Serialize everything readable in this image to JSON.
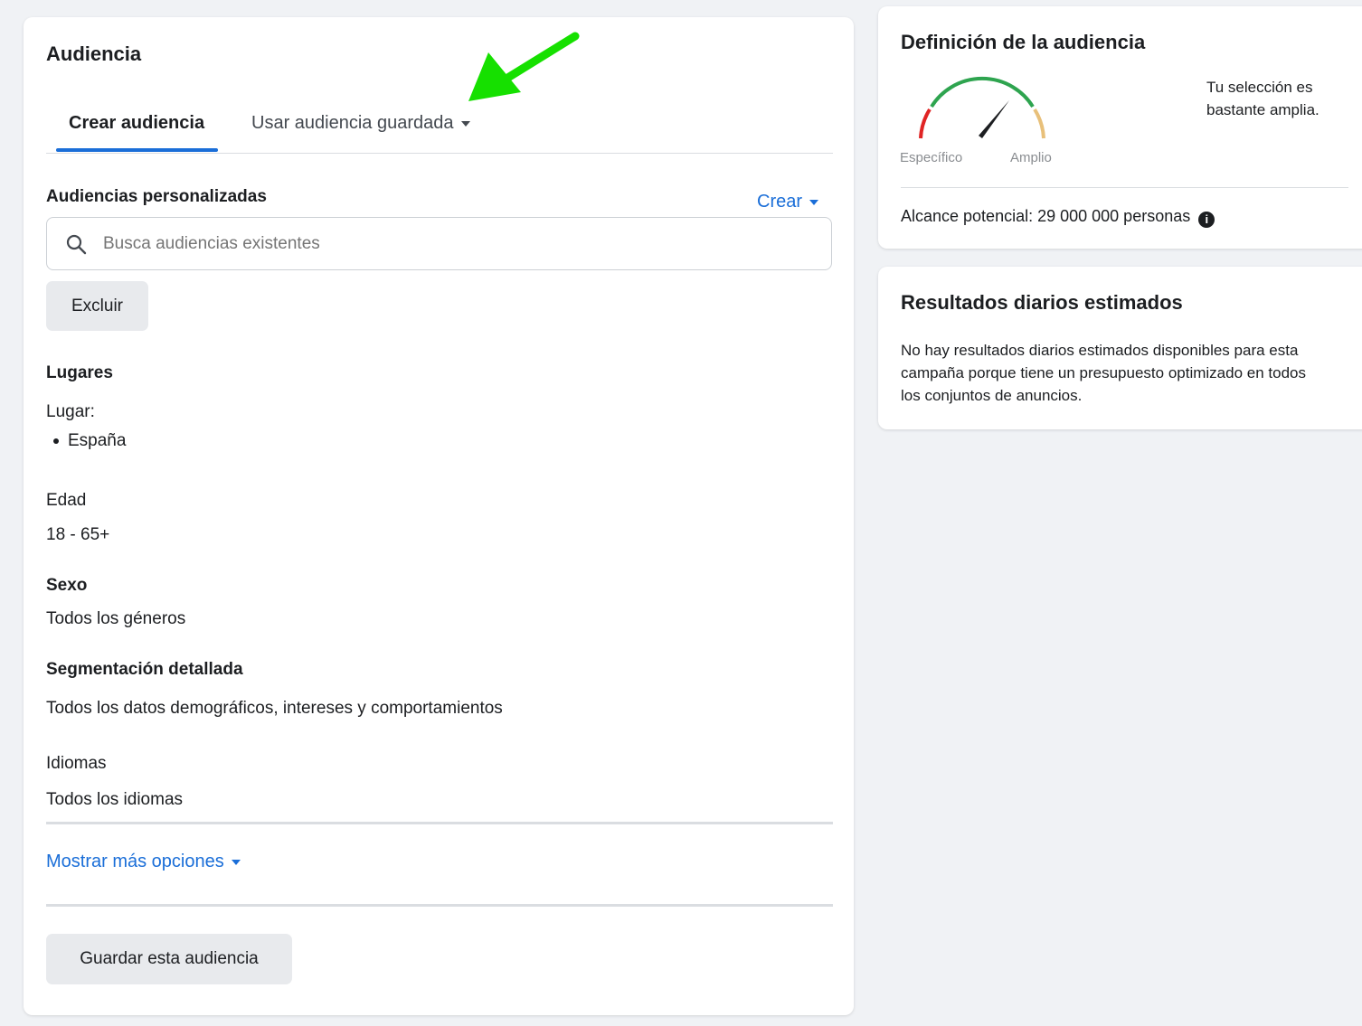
{
  "audience_panel": {
    "title": "Audiencia",
    "tabs": [
      {
        "label": "Crear audiencia",
        "active": true
      },
      {
        "label": "Usar audiencia guardada",
        "active": false
      }
    ],
    "custom_audiences": {
      "label": "Audiencias personalizadas",
      "create_label": "Crear",
      "search_placeholder": "Busca audiencias existentes",
      "exclude_label": "Excluir"
    },
    "locations": {
      "label": "Lugares",
      "sublabel": "Lugar:",
      "items": [
        "España"
      ]
    },
    "age": {
      "label": "Edad",
      "value": "18 - 65+"
    },
    "gender": {
      "label": "Sexo",
      "value": "Todos los géneros"
    },
    "detailed_targeting": {
      "label": "Segmentación detallada",
      "value": "Todos los datos demográficos, intereses y comportamientos"
    },
    "languages": {
      "label": "Idiomas",
      "value": "Todos los idiomas"
    },
    "more_options_label": "Mostrar más opciones",
    "save_audience_label": "Guardar esta audiencia"
  },
  "audience_definition": {
    "title": "Definición de la audiencia",
    "gauge_left_label": "Específico",
    "gauge_right_label": "Amplio",
    "gauge_position": "broad",
    "selection_text_line1": "Tu selección es",
    "selection_text_line2": "bastante amplia.",
    "potential_reach": "Alcance potencial: 29 000 000 personas"
  },
  "daily_results": {
    "title": "Resultados diarios estimados",
    "line1": "No hay resultados diarios estimados disponibles para esta",
    "line2": "campaña porque tiene un presupuesto optimizado en todos",
    "line3": "los conjuntos de anuncios."
  },
  "colors": {
    "accent": "#1a6ed8",
    "arrow": "#16e000",
    "gauge_red": "#e02424",
    "gauge_green": "#2ea44f",
    "gauge_yellow": "#e8c07a"
  },
  "icons": [
    "search-icon",
    "caret-down-icon",
    "info-icon",
    "gauge-needle-icon",
    "annotation-arrow-icon"
  ]
}
